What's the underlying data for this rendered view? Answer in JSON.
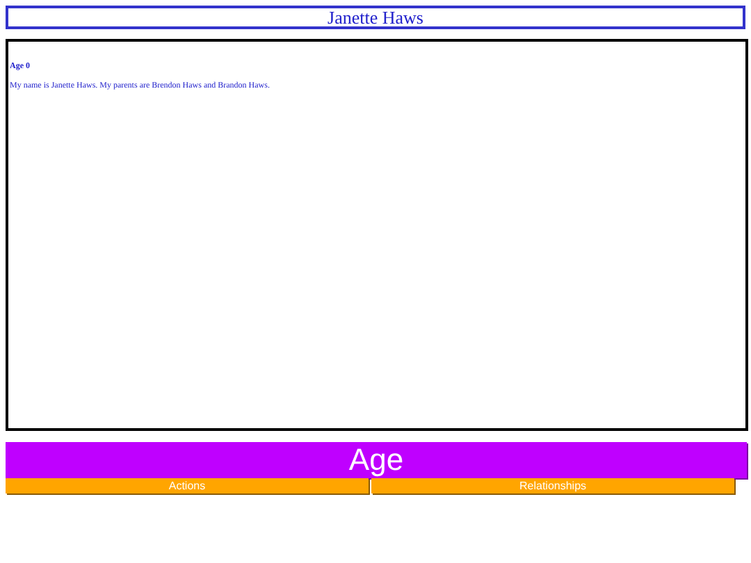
{
  "title": "Janette Haws",
  "log": {
    "heading": "Age 0",
    "text": "My name is Janette Haws. My parents are Brendon Haws and Brandon Haws."
  },
  "age_button": "Age",
  "buttons": [
    "Actions",
    "Relationships"
  ]
}
